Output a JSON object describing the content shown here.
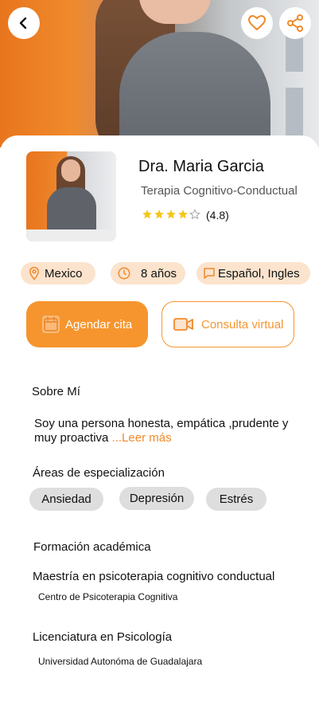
{
  "profile": {
    "name": "Dra. Maria Garcia",
    "specialty": "Terapia Cognitivo-Conductual",
    "rating_text": "(4.8)",
    "stars_filled": 4,
    "stars_total": 5
  },
  "chips": {
    "location": "Mexico",
    "experience": "8 años",
    "languages": "Español, Ingles"
  },
  "actions": {
    "schedule": "Agendar cita",
    "virtual": "Consulta virtual"
  },
  "about": {
    "title": "Sobre Mí",
    "text": "Soy una persona honesta, empática ,prudente y muy proactiva",
    "more": "...Leer más"
  },
  "specialization": {
    "title": "Áreas de especialización",
    "tags": [
      "Ansiedad",
      "Depresión",
      "Estrés"
    ]
  },
  "education": {
    "title": "Formación académica",
    "items": [
      {
        "degree": "Maestría en psicoterapia cognitivo conductual",
        "institution": "Centro de Psicoterapia Cognitiva"
      },
      {
        "degree": "Licenciatura en Psicología",
        "institution": "Universidad Autonóma de Guadalajara"
      }
    ]
  },
  "icons": {
    "back": "chevron-left-icon",
    "favorite": "heart-icon",
    "share": "share-icon",
    "location": "map-pin-icon",
    "experience": "clock-icon",
    "language": "chat-icon",
    "calendar": "calendar-icon",
    "video": "video-camera-icon"
  },
  "colors": {
    "accent": "#f6952e",
    "chip_bg": "#fbe3cd",
    "tag_bg": "#dedede",
    "star": "#f5c518"
  }
}
